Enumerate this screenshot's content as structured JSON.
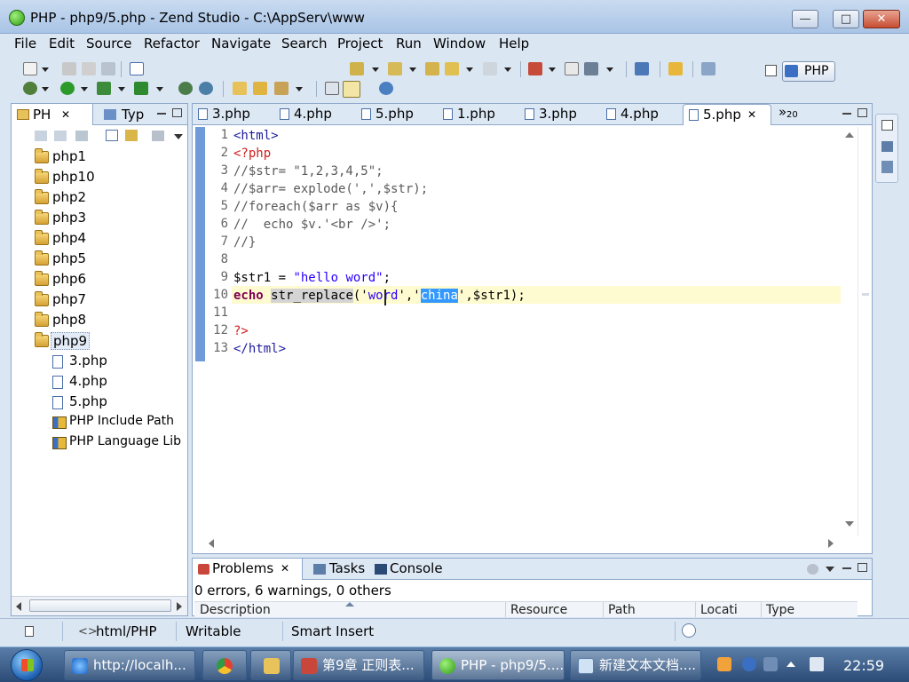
{
  "window": {
    "title": "PHP - php9/5.php - Zend Studio - C:\\AppServ\\www"
  },
  "window_controls": {
    "minimize": "—",
    "maximize": "□",
    "close": "✕"
  },
  "menu": [
    "File",
    "Edit",
    "Source",
    "Refactor",
    "Navigate",
    "Search",
    "Project",
    "Run",
    "Window",
    "Help"
  ],
  "perspective": {
    "label": "PHP"
  },
  "explorer": {
    "tabs": [
      {
        "label": "PH",
        "close": "✕"
      },
      {
        "label": "Typ"
      }
    ],
    "projects": [
      "php1",
      "php10",
      "php2",
      "php3",
      "php4",
      "php5",
      "php6",
      "php7",
      "php8",
      "php9"
    ],
    "files": [
      "3.php",
      "4.php",
      "5.php"
    ],
    "libraries": [
      "PHP Include Path",
      "PHP Language Lib"
    ]
  },
  "editor": {
    "tabs": [
      "3.php",
      "4.php",
      "5.php",
      "1.php",
      "3.php",
      "4.php",
      "5.php"
    ],
    "active_tab_close": "✕",
    "overflow": {
      "symbol": "»",
      "count": "20"
    },
    "line_numbers": [
      "1",
      "2",
      "3",
      "4",
      "5",
      "6",
      "7",
      "8",
      "9",
      "10",
      "11",
      "12",
      "13"
    ],
    "code": {
      "l1": "<html>",
      "l2": "<?php",
      "l3": "//$str= \"1,2,3,4,5\";",
      "l4": "//$arr= explode(',',$str);",
      "l5": "//foreach($arr as $v){",
      "l6": "//  echo $v.'<br />';",
      "l7": "//}",
      "l9a": "$str1 = ",
      "l9b": "\"hello word\"",
      "l9c": ";",
      "l10_kw": "echo",
      "l10_fn": "str_replace",
      "l10_a": "('",
      "l10_b": "word",
      "l10_c": "','",
      "l10_sel": "china",
      "l10_d": "',$str1);",
      "l12": "?>",
      "l13": "</html>"
    }
  },
  "bottom_panel": {
    "tabs": [
      {
        "label": "Problems",
        "close": "✕"
      },
      {
        "label": "Tasks"
      },
      {
        "label": "Console"
      }
    ],
    "summary": "0 errors, 6 warnings, 0 others",
    "columns": [
      "Description",
      "Resource",
      "Path",
      "Locati",
      "Type"
    ]
  },
  "statusbar": {
    "mode": "html/PHP",
    "writable": "Writable",
    "insert": "Smart Insert"
  },
  "taskbar": {
    "items": [
      "http://localh...",
      "",
      "",
      "第9章 正则表...",
      "PHP - php9/5....",
      "新建文本文档...."
    ],
    "clock": "22:59"
  },
  "colors": {
    "accent": "#3399ff",
    "keyword": "#7f0055",
    "string": "#2a00ff",
    "current_line": "#fffbd0"
  }
}
